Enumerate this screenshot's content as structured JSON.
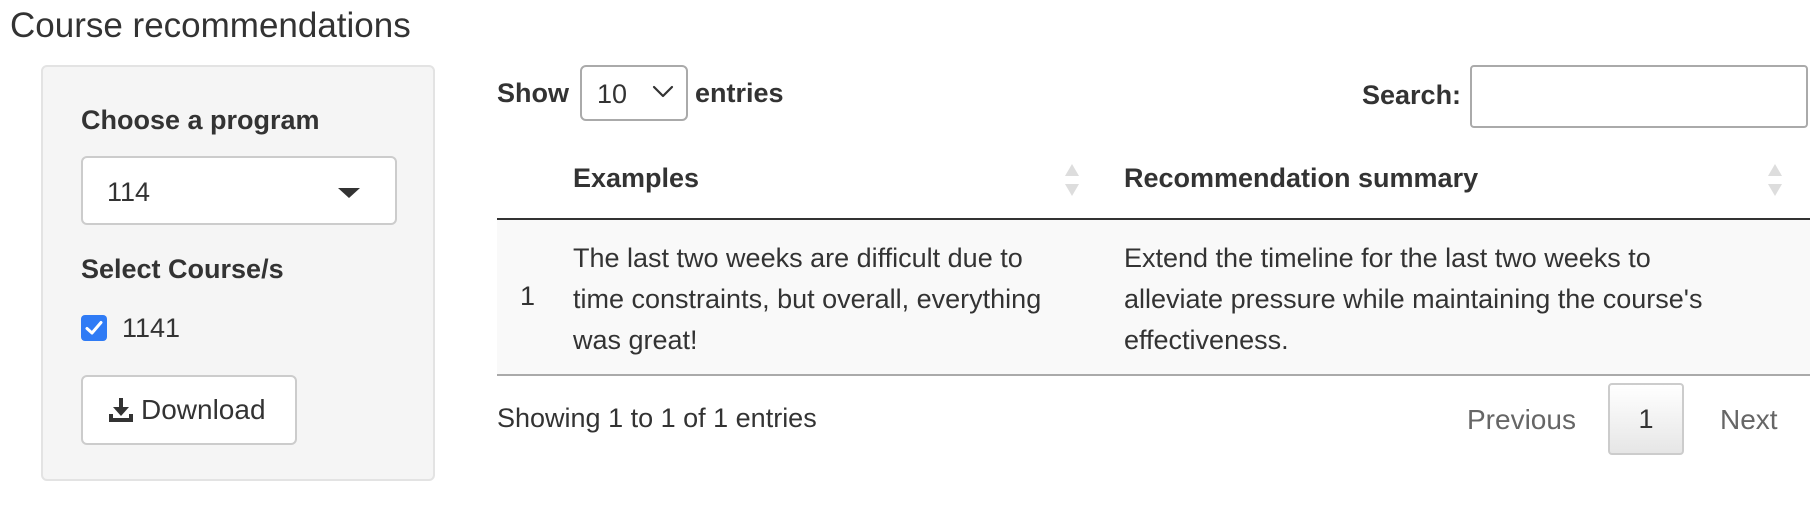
{
  "page": {
    "title": "Course recommendations"
  },
  "sidebar": {
    "program_label": "Choose a program",
    "program_value": "114",
    "courses_label": "Select Course/s",
    "course_option": {
      "label": "1141",
      "checked": true
    },
    "download_label": "Download",
    "accent_color": "#2f7bf5"
  },
  "table": {
    "length": {
      "show_label": "Show",
      "value": "10",
      "entries_label": "entries"
    },
    "search": {
      "label": "Search:",
      "value": ""
    },
    "columns": [
      "Examples",
      "Recommendation summary"
    ],
    "rows": [
      {
        "index": "1",
        "example_lines": [
          "The last two weeks are difficult due to",
          "time constraints, but overall, everything",
          "was great!"
        ],
        "summary_lines": [
          "Extend the timeline for the last two weeks to",
          "alleviate pressure while maintaining the course's",
          "effectiveness."
        ]
      }
    ],
    "info": "Showing 1 to 1 of 1 entries",
    "pagination": {
      "previous": "Previous",
      "current": "1",
      "next": "Next"
    }
  }
}
